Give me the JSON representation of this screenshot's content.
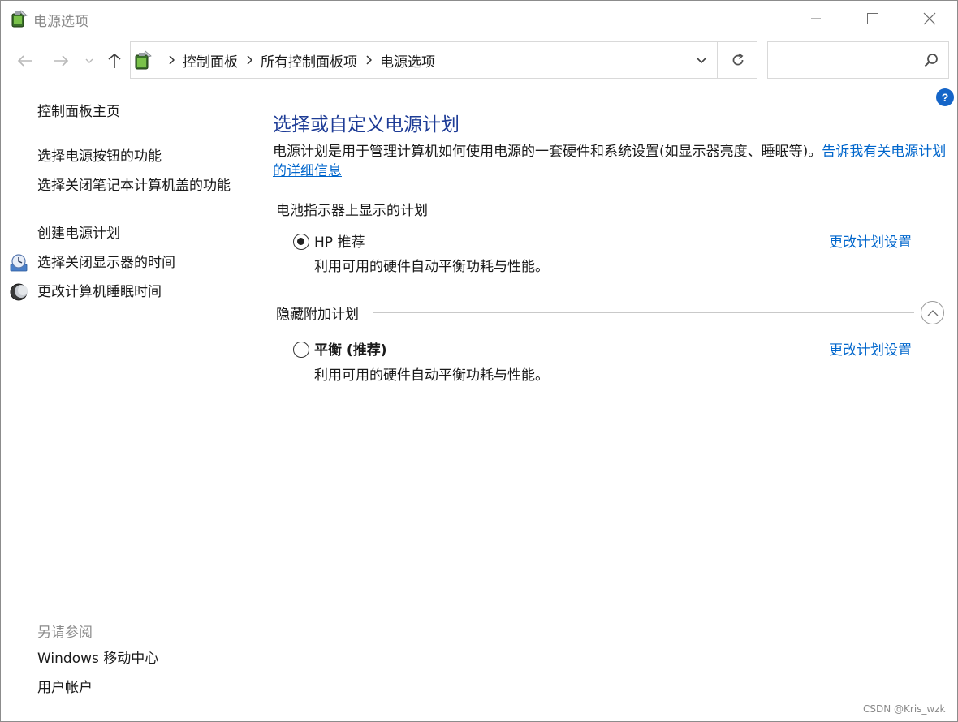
{
  "window": {
    "title": "电源选项",
    "controls": {
      "minimize": "minimize",
      "maximize": "maximize",
      "close": "close"
    }
  },
  "navigation": {
    "breadcrumbs": [
      "控制面板",
      "所有控制面板项",
      "电源选项"
    ],
    "search_placeholder": ""
  },
  "sidebar": {
    "home": "控制面板主页",
    "links": [
      "选择电源按钮的功能",
      "选择关闭笔记本计算机盖的功能",
      "创建电源计划",
      "选择关闭显示器的时间",
      "更改计算机睡眠时间"
    ],
    "see_also_label": "另请参阅",
    "see_also_links": [
      "Windows 移动中心",
      "用户帐户"
    ]
  },
  "main": {
    "title": "选择或自定义电源计划",
    "description": "电源计划是用于管理计算机如何使用电源的一套硬件和系统设置(如显示器亮度、睡眠等)。",
    "description_link": "告诉我有关电源计划的详细信息",
    "battery_section": "电池指示器上显示的计划",
    "hidden_section": "隐藏附加计划",
    "plans": [
      {
        "name": "HP 推荐",
        "description": "利用可用的硬件自动平衡功耗与性能。",
        "link": "更改计划设置",
        "selected": true
      },
      {
        "name": "平衡 (推荐)",
        "description": "利用可用的硬件自动平衡功耗与性能。",
        "link": "更改计划设置",
        "selected": false
      }
    ]
  },
  "watermark": "CSDN @Kris_wzk",
  "colors": {
    "title_blue": "#1e3c96",
    "link_blue": "#0066cc",
    "help_blue": "#1565c8"
  }
}
